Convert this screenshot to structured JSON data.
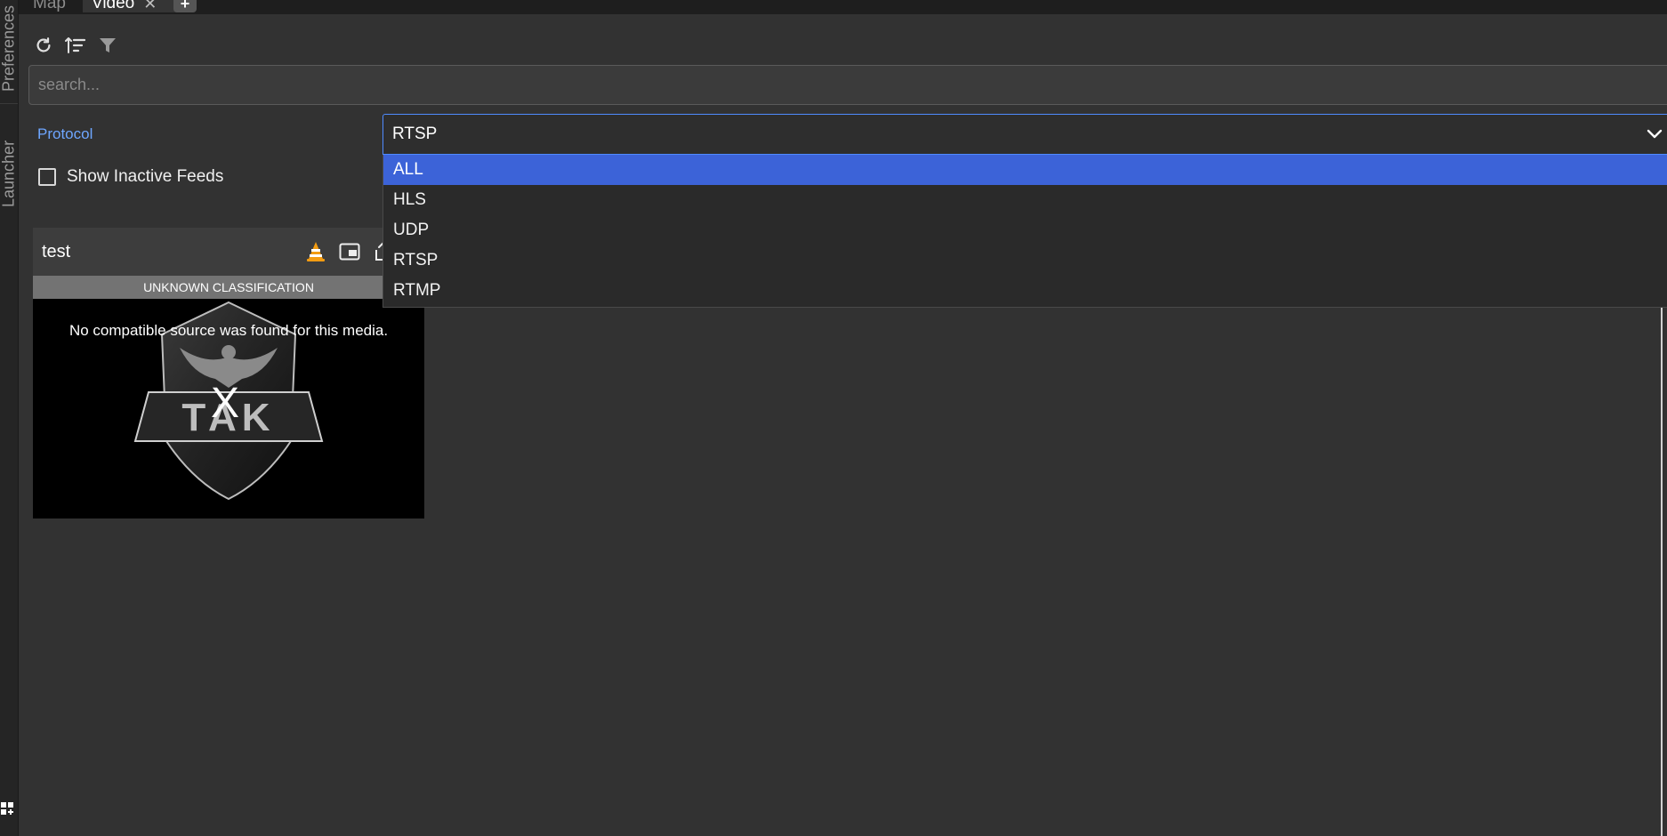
{
  "left_rail": {
    "preferences_label": "Preferences",
    "launcher_label": "Launcher"
  },
  "tabs": {
    "map_label": "Map",
    "video_label": "Video",
    "close_glyph": "✕",
    "add_glyph": "+"
  },
  "toolbar": {
    "icons": [
      "refresh-icon",
      "sort-icon",
      "filter-icon"
    ]
  },
  "search": {
    "placeholder": "search...",
    "value": ""
  },
  "protocol": {
    "label": "Protocol",
    "selected": "RTSP",
    "options": [
      "ALL",
      "HLS",
      "UDP",
      "RTSP",
      "RTMP"
    ],
    "highlighted": "ALL"
  },
  "filters": {
    "show_inactive_label": "Show Inactive Feeds",
    "show_inactive_checked": false
  },
  "card": {
    "title": "test",
    "classification": "UNKNOWN CLASSIFICATION",
    "message": "No compatible source was found for this media.",
    "close_glyph": "X",
    "logo_text": "TAK",
    "icons": [
      "vlc-icon",
      "picture-in-picture-icon",
      "share-icon"
    ]
  },
  "colors": {
    "accent": "#3c63d8",
    "label_blue": "#6ea6ff",
    "vlc_orange": "#f39c12"
  }
}
